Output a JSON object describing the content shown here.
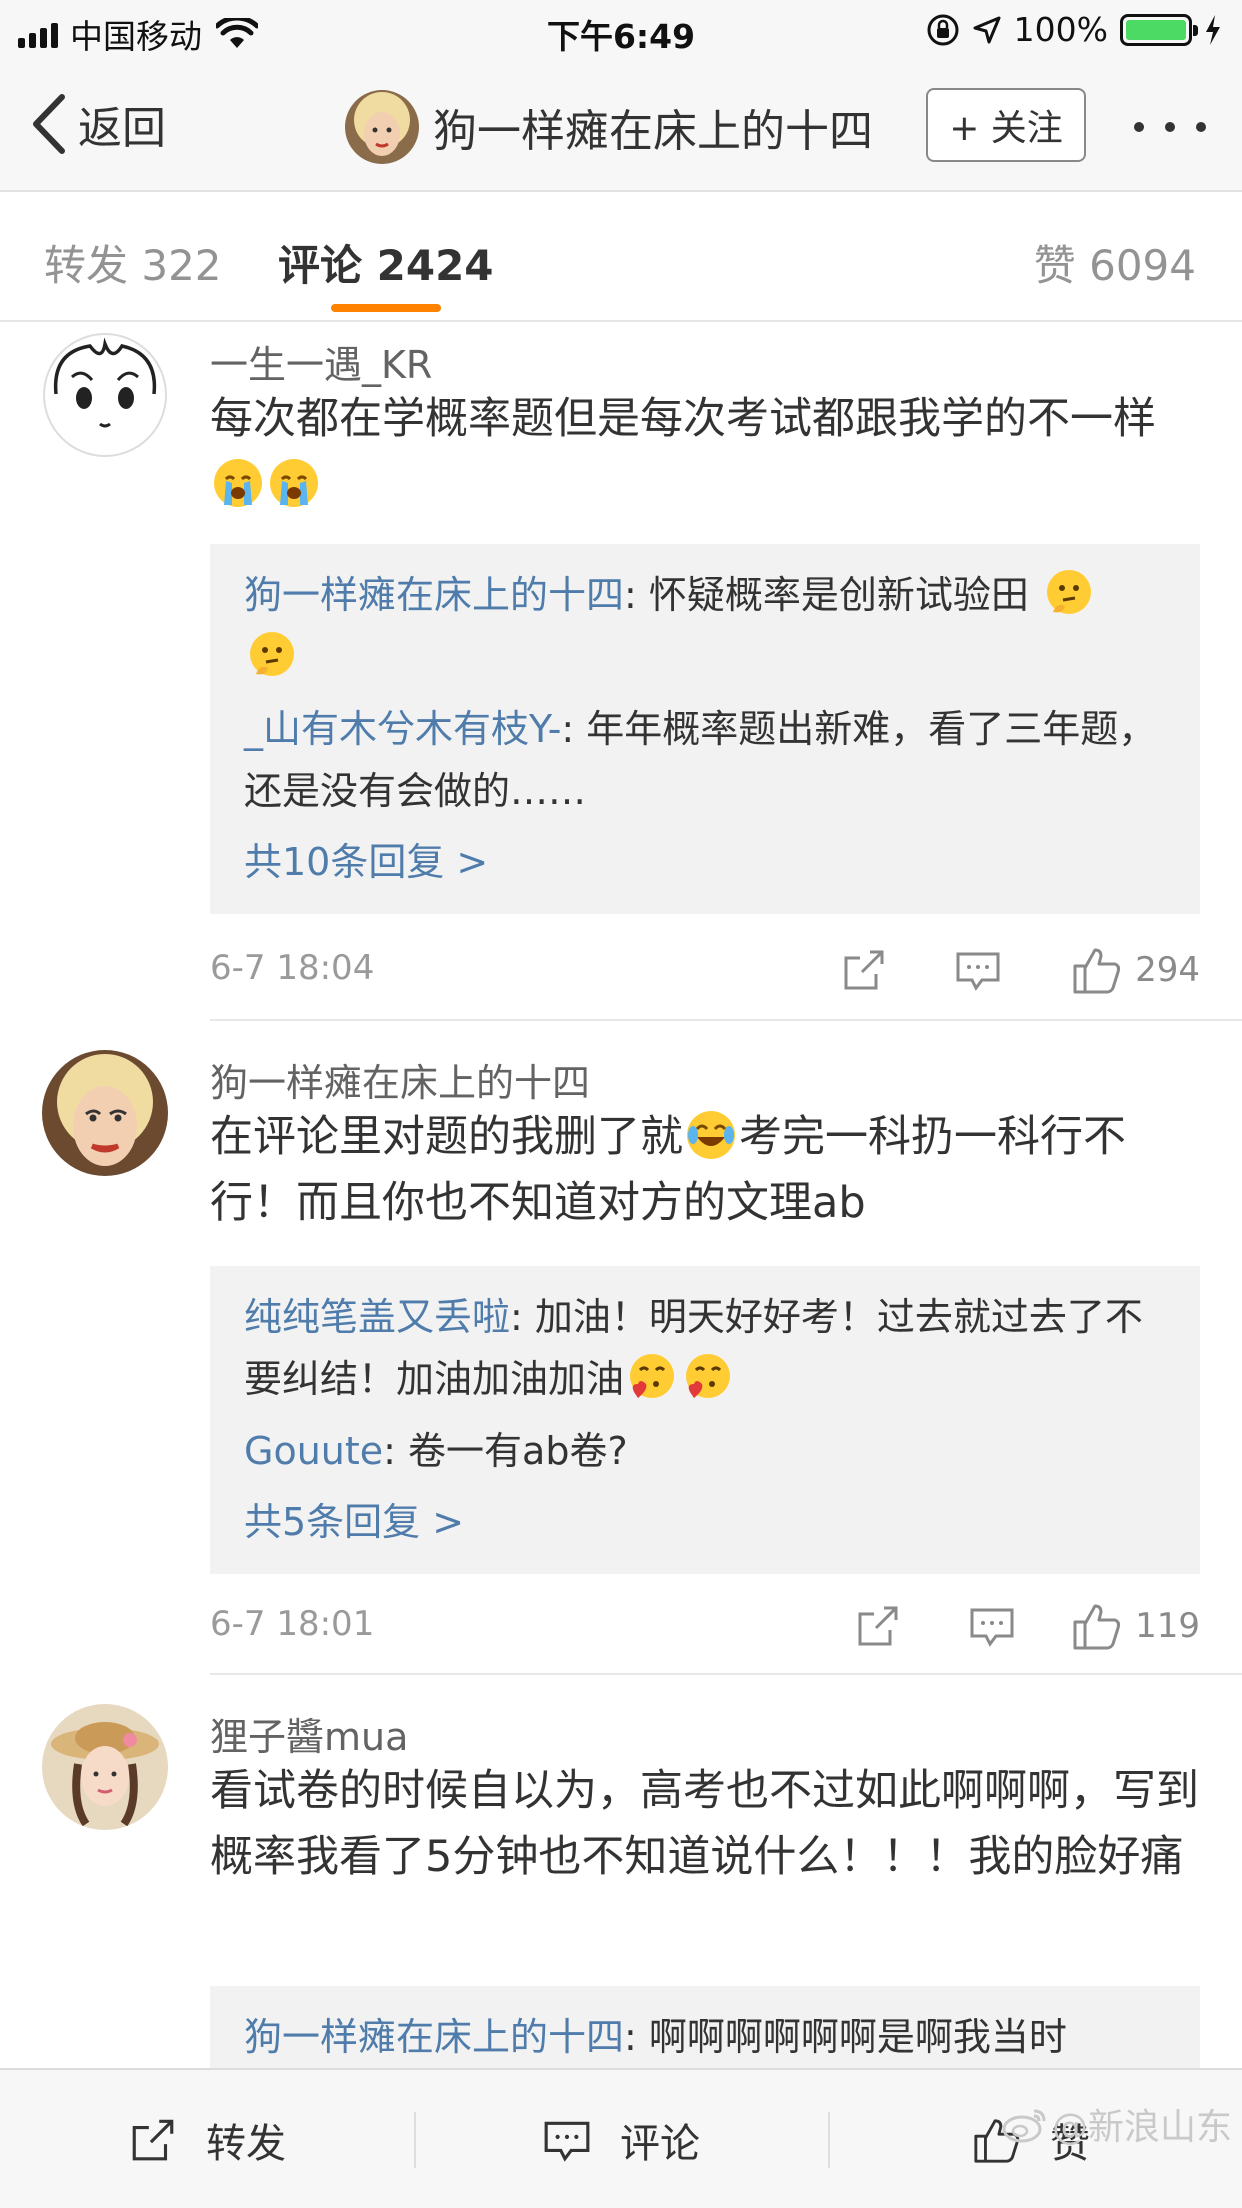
{
  "status_bar": {
    "carrier": "中国移动",
    "time": "下午6:49",
    "battery_text": "100%",
    "battery_level": 1.0,
    "battery_color": "#4cd964",
    "icons": [
      "signal-icon",
      "wifi-icon",
      "orientation-lock-icon",
      "location-icon",
      "battery-icon",
      "charging-icon"
    ]
  },
  "nav": {
    "back_label": "返回",
    "title": "狗一样瘫在床上的十四",
    "follow_label": "+ 关注"
  },
  "tabs": {
    "repost": "转发 322",
    "comments": "评论 2424",
    "likes": "赞 6094",
    "active": "comments",
    "accent_color": "#ff8200"
  },
  "comments": [
    {
      "user": "一生一遇_KR",
      "text": "每次都在学概率题但是每次考试都跟我学的不一样",
      "trailing_emojis": [
        "crying-emoji",
        "crying-emoji"
      ],
      "replies": [
        {
          "name": "狗一样瘫在床上的十四",
          "text": ": 怀疑概率是创新试验田",
          "emojis": [
            "thinking-emoji",
            "thinking-emoji"
          ]
        },
        {
          "name": "_山有木兮木有枝Y-",
          "text": ": 年年概率题出新难，看了三年题，还是没有会做的……",
          "emojis": []
        }
      ],
      "more_replies": "共10条回复 >",
      "time": "6-7 18:04",
      "likes": "294"
    },
    {
      "user": "狗一样瘫在床上的十四",
      "text_before_emoji": "在评论里对题的我删了就",
      "inline_emoji": "laugh-cry-emoji",
      "text_after_emoji": "考完一科扔一科行不行！而且你也不知道对方的文理ab",
      "replies": [
        {
          "name": "纯纯笔盖又丢啦",
          "text": ": 加油！明天好好考！过去就过去了不要纠结！加油加油加油",
          "emojis": [
            "kissing-heart-emoji",
            "kissing-heart-emoji"
          ]
        },
        {
          "name": "Gouute",
          "text": ": 卷一有ab卷?",
          "emojis": []
        }
      ],
      "more_replies": "共5条回复 >",
      "time": "6-7 18:01",
      "likes": "119"
    },
    {
      "user": "狸子醬mua",
      "text": "看试卷的时候自以为，高考也不过如此啊啊啊，写到概率我看了5分钟也不知道说什么！！！我的脸好痛",
      "replies": [
        {
          "name": "狗一样瘫在床上的十四",
          "text": ": 啊啊啊啊啊啊是啊我当时",
          "emojis": []
        }
      ]
    }
  ],
  "bottom_bar": {
    "repost": "转发",
    "comment": "评论",
    "like": "赞"
  },
  "watermark": "@新浪山东",
  "colors": {
    "link_blue": "#4f7cab",
    "reply_bg": "#f2f2f2"
  }
}
